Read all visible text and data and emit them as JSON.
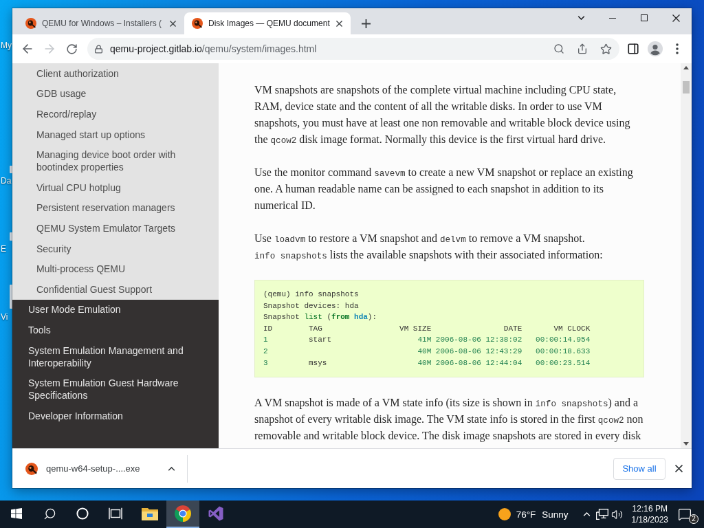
{
  "desktop_icons": [
    {
      "label": "My"
    },
    {
      "label": "Da"
    },
    {
      "label": "E"
    },
    {
      "label": "Vi"
    }
  ],
  "browser": {
    "tabs": [
      {
        "title": "QEMU for Windows – Installers (",
        "selected": false
      },
      {
        "title": "Disk Images — QEMU document",
        "selected": true
      }
    ],
    "navigation": {
      "back_disabled": false,
      "forward_disabled": true
    },
    "address": {
      "host": "qemu-project.gitlab.io",
      "path": "/qemu/system/images.html"
    }
  },
  "sidebar": {
    "open_section_items": [
      {
        "label": "Client authorization"
      },
      {
        "label": "GDB usage"
      },
      {
        "label": "Record/replay"
      },
      {
        "label": "Managed start up options"
      },
      {
        "label": "Managing device boot order with bootindex properties"
      },
      {
        "label": "Virtual CPU hotplug"
      },
      {
        "label": "Persistent reservation managers"
      },
      {
        "label": "QEMU System Emulator Targets"
      },
      {
        "label": "Security"
      },
      {
        "label": "Multi-process QEMU"
      },
      {
        "label": "Confidential Guest Support"
      }
    ],
    "items": [
      {
        "label": "User Mode Emulation"
      },
      {
        "label": "Tools"
      },
      {
        "label": "System Emulation Management and Interoperability"
      },
      {
        "label": "System Emulation Guest Hardware Specifications"
      },
      {
        "label": "Developer Information"
      }
    ]
  },
  "article": {
    "blocks": [
      {
        "kind": "paragraph",
        "segments": [
          {
            "kind": "text",
            "text": "VM snapshots are snapshots of the complete virtual machine including CPU state, RAM, device state and the content of all the writable disks. In order to use VM snapshots, you must have at least one non removable and writable block device using the "
          },
          {
            "kind": "code",
            "text": "qcow2"
          },
          {
            "kind": "text",
            "text": " disk image format. Normally this device is the first virtual hard drive."
          }
        ]
      },
      {
        "kind": "paragraph",
        "segments": [
          {
            "kind": "text",
            "text": "Use the monitor command "
          },
          {
            "kind": "code",
            "text": "savevm"
          },
          {
            "kind": "text",
            "text": " to create a new VM snapshot or replace an existing one. A human readable name can be assigned to each snapshot in addition to its numerical ID."
          }
        ]
      },
      {
        "kind": "paragraph",
        "segments": [
          {
            "kind": "text",
            "text": "Use "
          },
          {
            "kind": "code",
            "text": "loadvm"
          },
          {
            "kind": "text",
            "text": " to restore a VM snapshot and "
          },
          {
            "kind": "code",
            "text": "delvm"
          },
          {
            "kind": "text",
            "text": " to remove a VM snapshot. "
          },
          {
            "kind": "code",
            "text": "info snapshots"
          },
          {
            "kind": "text",
            "text": " lists the available snapshots with their associated information:"
          }
        ]
      },
      {
        "kind": "code",
        "lines": [
          [
            {
              "kind": "text",
              "text": "(qemu) info snapshots"
            }
          ],
          [
            {
              "kind": "text",
              "text": "Snapshot devices: hda"
            }
          ],
          [
            {
              "kind": "text",
              "text": "Snapshot "
            },
            {
              "kind": "builtin",
              "text": "list"
            },
            {
              "kind": "text",
              "text": " ("
            },
            {
              "kind": "keyword",
              "text": "from "
            },
            {
              "kind": "namespace",
              "text": "hda"
            },
            {
              "kind": "text",
              "text": "):"
            }
          ],
          [
            {
              "kind": "text",
              "text": "ID        TAG                 VM SIZE                DATE       VM CLOCK"
            }
          ],
          [
            {
              "kind": "number",
              "text": "1"
            },
            {
              "kind": "text",
              "text": "         start                   "
            },
            {
              "kind": "number",
              "text": "41M 2006-08-06 12:38:02   00:00:14.954"
            }
          ],
          [
            {
              "kind": "number",
              "text": "2                                 40M 2006-08-06 12:43:29   00:00:18.633"
            }
          ],
          [
            {
              "kind": "number",
              "text": "3"
            },
            {
              "kind": "text",
              "text": "         msys                    "
            },
            {
              "kind": "number",
              "text": "40M 2006-08-06 12:44:04   00:00:23.514"
            }
          ]
        ]
      },
      {
        "kind": "paragraph",
        "segments": [
          {
            "kind": "text",
            "text": "A VM snapshot is made of a VM state info (its size is shown in "
          },
          {
            "kind": "code",
            "text": "info snapshots"
          },
          {
            "kind": "text",
            "text": ") and a snapshot of every writable disk image. The VM state info is stored in the first "
          },
          {
            "kind": "code",
            "text": "qcow2"
          },
          {
            "kind": "text",
            "text": " non removable and writable block device. The disk image snapshots are stored in every disk"
          }
        ]
      }
    ]
  },
  "downloads": {
    "items": [
      {
        "file": "qemu-w64-setup-....exe"
      }
    ],
    "show_all": "Show all"
  },
  "taskbar": {
    "apps": [
      {
        "kind": "explorer",
        "active": false
      },
      {
        "kind": "chrome",
        "active": true
      },
      {
        "kind": "visual-studio",
        "active": false
      }
    ],
    "weather": {
      "temperature": "76°F",
      "condition": "Sunny"
    },
    "time": "12:16 PM",
    "date": "1/18/2023",
    "notifications": "2"
  }
}
